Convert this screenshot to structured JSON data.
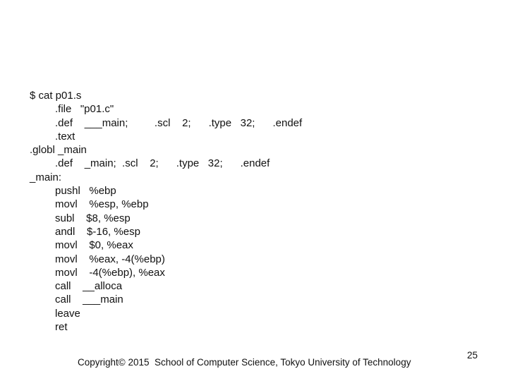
{
  "slide": {
    "code_lines": [
      {
        "text": "$ cat p01.s",
        "indent": false
      },
      {
        "text": ".file   \"p01.c\"",
        "indent": true
      },
      {
        "text": ".def    ___main;         .scl    2;      .type   32;      .endef",
        "indent": true
      },
      {
        "text": ".text",
        "indent": true
      },
      {
        "text": ".globl _main",
        "indent": false
      },
      {
        "text": ".def    _main;  .scl    2;      .type   32;      .endef",
        "indent": true
      },
      {
        "text": "_main:",
        "indent": false
      },
      {
        "text": "pushl   %ebp",
        "indent": true
      },
      {
        "text": "movl    %esp, %ebp",
        "indent": true
      },
      {
        "text": "subl    $8, %esp",
        "indent": true
      },
      {
        "text": "andl    $-16, %esp",
        "indent": true
      },
      {
        "text": "movl    $0, %eax",
        "indent": true
      },
      {
        "text": "movl    %eax, -4(%ebp)",
        "indent": true
      },
      {
        "text": "movl    -4(%ebp), %eax",
        "indent": true
      },
      {
        "text": "call    __alloca",
        "indent": true
      },
      {
        "text": "call    ___main",
        "indent": true
      },
      {
        "text": "leave",
        "indent": true
      },
      {
        "text": "ret",
        "indent": true
      }
    ],
    "footer": "Copyright© 2015  School of Computer Science, Tokyo University of Technology",
    "page_number": "25"
  }
}
